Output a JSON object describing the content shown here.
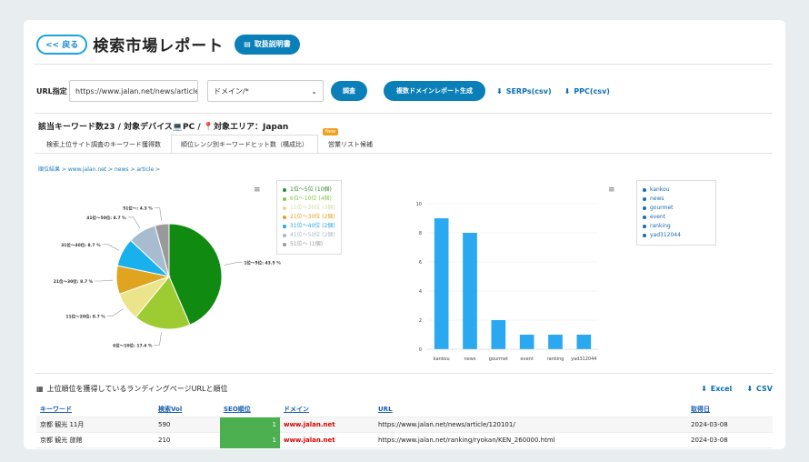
{
  "header": {
    "back_label": "<< 戻る",
    "title": "検索市場レポート",
    "manual_label": "取扱説明書"
  },
  "form": {
    "url_label": "URL指定",
    "url_value": "https://www.jalan.net/news/article",
    "domain_select": "ドメイン/*",
    "search_button": "調査",
    "multi_button": "複数ドメインレポート生成",
    "serps_csv": "SERPs(csv)",
    "ppc_csv": "PPC(csv)"
  },
  "summary": "該当キーワード数23 / 対象デバイス💻PC / 📍対象エリア：Japan",
  "tabs": [
    {
      "label": "検索上位サイト調査のキーワード獲得数"
    },
    {
      "label": "順位レンジ別キーワードヒット数（構成比）"
    },
    {
      "label": "営業リスト候補",
      "badge": "New"
    }
  ],
  "breadcrumb": "順位結果 > www.jalan.net > news > article >",
  "pie_legend": [
    {
      "label": "1位〜5位 (10個)",
      "color": "#2e8b2e"
    },
    {
      "label": "6位〜10位 (4個)",
      "color": "#8bc34a"
    },
    {
      "label": "11位〜20位 (3個)",
      "color": "#d8d8a0"
    },
    {
      "label": "21位〜30位 (2個)",
      "color": "#e0a020"
    },
    {
      "label": "31位〜40位 (2個)",
      "color": "#20a8e8"
    },
    {
      "label": "41位〜50位 (2個)",
      "color": "#a8b8c8"
    },
    {
      "label": "51位〜 (1個)",
      "color": "#999999"
    }
  ],
  "chart_data": [
    {
      "type": "pie",
      "labels": [
        "1位〜5位: 43.5 %",
        "6位〜10位: 17.4 %",
        "11位〜20位: 8.7 %",
        "21位〜30位: 8.7 %",
        "31位〜40位: 8.7 %",
        "41位〜50位: 8.7 %",
        "51位〜: 4.3 %"
      ],
      "values": [
        43.5,
        17.4,
        8.7,
        8.7,
        8.7,
        8.7,
        4.3
      ],
      "colors": [
        "#118a11",
        "#9ccc32",
        "#ece48a",
        "#dfa521",
        "#19b0ee",
        "#a8bcd0",
        "#999999"
      ]
    },
    {
      "type": "bar",
      "categories": [
        "kankou",
        "news",
        "gourmet",
        "event",
        "ranking",
        "yad312044"
      ],
      "values": [
        9,
        8,
        2,
        1,
        1,
        1
      ],
      "ylim": [
        0,
        10
      ],
      "yticks": [
        "0",
        "2",
        "4",
        "6",
        "8",
        "10"
      ],
      "color": "#2aa8f0",
      "legend": [
        "kankou",
        "news",
        "gourmet",
        "event",
        "ranking",
        "yad312044"
      ]
    }
  ],
  "table": {
    "title": "上位順位を獲得しているランディングページURLと順位",
    "excel_label": "Excel",
    "csv_label": "CSV",
    "columns": [
      "キーワード",
      "検索Vol",
      "SEO順位",
      "ドメイン",
      "URL",
      "取得日"
    ],
    "rows": [
      {
        "keyword": "京都 観光 11月",
        "vol": "590",
        "seo": "1",
        "domain": "www.jalan.net",
        "url": "https://www.jalan.net/news/article/120101/",
        "date": "2024-03-08"
      },
      {
        "keyword": "京都 観光 旅館",
        "vol": "210",
        "seo": "1",
        "domain": "www.jalan.net",
        "url": "https://www.jalan.net/ranking/ryokan/KEN_260000.html",
        "date": "2024-03-08"
      }
    ]
  }
}
